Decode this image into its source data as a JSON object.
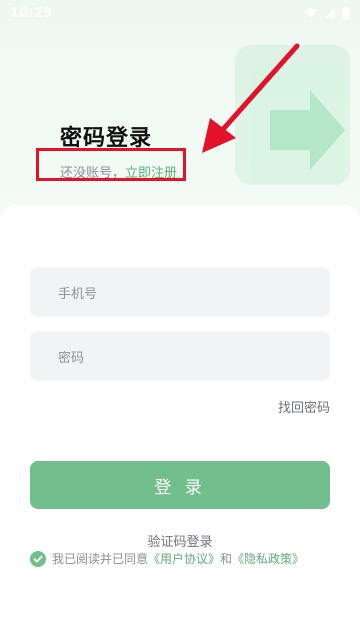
{
  "status": {
    "time": "10:29"
  },
  "title": "密码登录",
  "subtitle": {
    "prefix": "还没账号，",
    "link": "立即注册"
  },
  "form": {
    "phone_placeholder": "手机号",
    "password_placeholder": "密码",
    "forgot": "找回密码",
    "login": "登 录",
    "sms_login": "验证码登录"
  },
  "agreement": {
    "text_before": "我已阅读并已同意",
    "user_agreement": "《用户协议》",
    "and": "和",
    "privacy_policy": "《隐私政策》"
  },
  "colors": {
    "accent": "#72be8c",
    "highlight": "#e3112a"
  }
}
